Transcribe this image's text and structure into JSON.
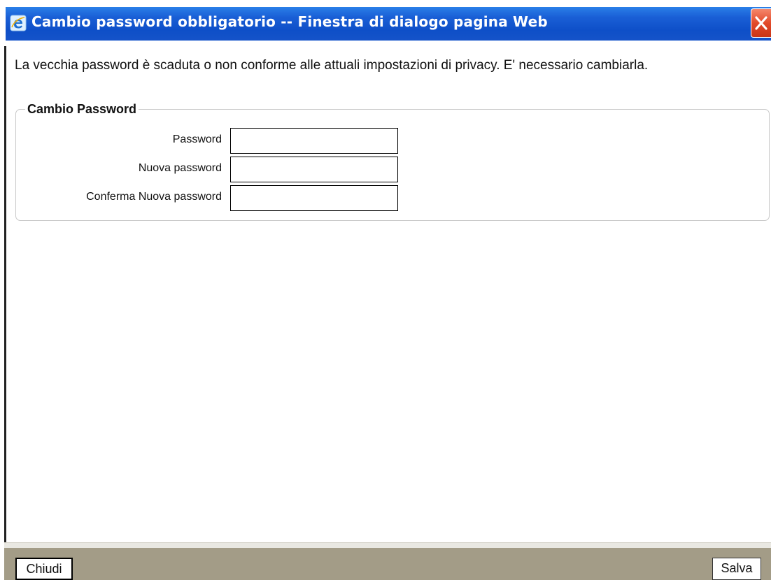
{
  "window": {
    "title": "Cambio password obbligatorio -- Finestra di dialogo pagina Web",
    "icon": "internet-explorer-icon",
    "close_icon": "close-icon"
  },
  "main": {
    "message": "La vecchia password è scaduta o non conforme alle attuali impostazioni di privacy. E' necessario cambiarla.",
    "group_title": "Cambio Password",
    "fields": [
      {
        "label": "Password",
        "value": ""
      },
      {
        "label": "Nuova password",
        "value": ""
      },
      {
        "label": "Conferma Nuova password",
        "value": ""
      }
    ]
  },
  "footer": {
    "close_label": "Chiudi",
    "save_label": "Salva"
  },
  "colors": {
    "titlebar": "#0e4fc8",
    "close_button": "#e24a2a",
    "footer": "#a39c87"
  }
}
